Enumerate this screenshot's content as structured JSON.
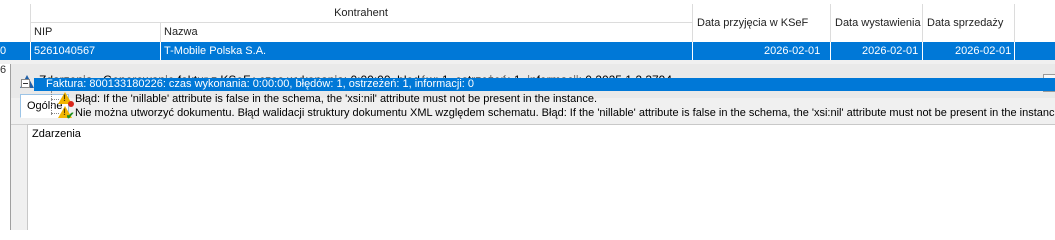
{
  "grid": {
    "group_header": "Kontrahent",
    "columns": {
      "nip": "NIP",
      "nazwa": "Nazwa",
      "data_ksef": "Data przyjęcia w KSeF",
      "data_wystawienia": "Data wystawienia",
      "data_sprzedazy": "Data sprzedaży"
    },
    "row": {
      "lp": "0",
      "nip": "5261040567",
      "nazwa": "T-Mobile Polska S.A.",
      "data_ksef": "2026-02-01",
      "data_wystawienia": "2026-02-01",
      "data_sprzedazy": "2026-02-01"
    },
    "left_marker": "6"
  },
  "dialog": {
    "title": "Zdarzenia - Generowanie faktur z KSeF.: czas wykonania:  0:00:00, błędów: 1, ostrzeżeń: 1, informacji: 0 2025.1.2.3794",
    "tab": "Ogólne",
    "panel_label": "Zdarzenia",
    "events": {
      "root": "Faktura: 800133180226: czas wykonania:  0:00:00, błędów: 1, ostrzeżeń: 1, informacji: 0",
      "error": "Błąd: If the 'nillable' attribute is false in the schema, the 'xsi:nil' attribute must not be present in the instance.",
      "warning": "Nie można utworzyć dokumentu. Błąd walidacji struktury dokumentu XML względem schematu. Błąd: If the 'nillable' attribute is false in the schema, the 'xsi:nil' attribute must not be present in the instance."
    }
  },
  "colors": {
    "selection": "#0078d7",
    "warning": "#f2b600",
    "error": "#d9261c",
    "ok": "#1d8f1d"
  }
}
